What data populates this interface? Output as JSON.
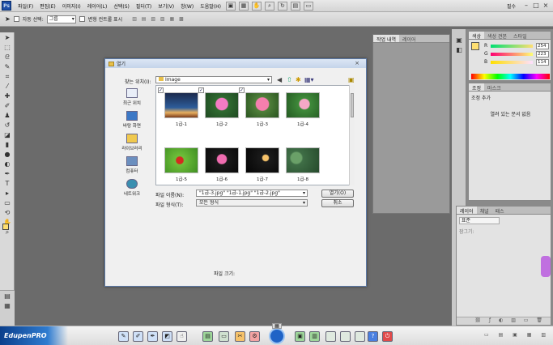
{
  "menubar": {
    "logo": "Ps",
    "items": [
      "파일(F)",
      "편집(E)",
      "이미지(I)",
      "레이어(L)",
      "선택(S)",
      "필터(T)",
      "보기(V)",
      "창(W)",
      "도움말(H)"
    ],
    "workspace": "필수",
    "window_controls": [
      "–",
      "□",
      "×"
    ]
  },
  "optionsbar": {
    "auto_select_label": "자동 선택:",
    "auto_select_value": "그룹",
    "transform_controls_label": "변형 컨트롤 표시"
  },
  "panels": {
    "top_tabs": [
      "작업 내역",
      "레이어"
    ],
    "color_tabs": [
      "색상",
      "색상 견본",
      "스타일"
    ],
    "rgb": [
      {
        "channel": "R",
        "value": "254"
      },
      {
        "channel": "G",
        "value": "223"
      },
      {
        "channel": "B",
        "value": "114"
      }
    ],
    "adjust_tabs": [
      "조정",
      "마스크"
    ],
    "adjust_title": "조정 추가",
    "adjust_message": "열려 있는 문서 없음",
    "layers_tabs": [
      "레이어",
      "채널",
      "패스"
    ],
    "blend_mode": "표준",
    "lock_label": "잠그기:"
  },
  "dialog": {
    "title": "열기",
    "look_in_label": "찾는 위치(I):",
    "look_in_value": "Image",
    "places": [
      "최근 위치",
      "바탕 화면",
      "라이브러리",
      "컴퓨터",
      "네트워크"
    ],
    "files": [
      {
        "name": "1급-1",
        "checked": true
      },
      {
        "name": "1급-2",
        "checked": true
      },
      {
        "name": "1급-3",
        "checked": true
      },
      {
        "name": "1급-4",
        "checked": false
      },
      {
        "name": "1급-5",
        "checked": false
      },
      {
        "name": "1급-6",
        "checked": false
      },
      {
        "name": "1급-7",
        "checked": false
      },
      {
        "name": "1급-8",
        "checked": false
      }
    ],
    "filename_label": "파일 이름(N):",
    "filename_value": "\"1급-3.jpg\" \"1급-1.jpg\" \"1급-2.jpg\"",
    "filetype_label": "파일 형식(T):",
    "filetype_value": "모든 형식",
    "open_button": "열기(O)",
    "cancel_button": "취소",
    "filesize_label": "파일 크기:"
  },
  "taskbar": {
    "brand": "EdupenPRO"
  },
  "colors": {
    "foreground": "#fedf72",
    "background": "#ffffff"
  }
}
